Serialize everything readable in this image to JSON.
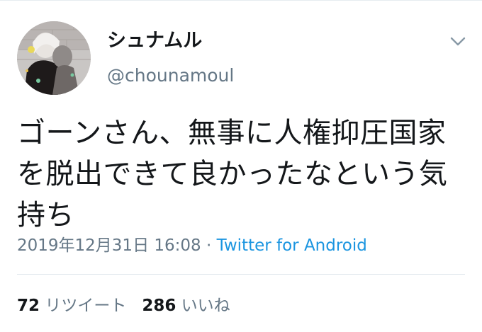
{
  "user": {
    "display_name": "シュナムル",
    "handle": "@chounamoul"
  },
  "tweet": {
    "text": "ゴーンさん、無事に人権抑圧国家を脱出できて良かったなという気持ち",
    "timestamp": "2019年12月31日 16:08",
    "separator": " · ",
    "source": "Twitter for Android"
  },
  "stats": {
    "retweets_count": "72",
    "retweets_label": "リツイート",
    "likes_count": "286",
    "likes_label": "いいね"
  },
  "icons": {
    "menu": "chevron-down-icon",
    "avatar": "avatar"
  },
  "colors": {
    "text": "#14171a",
    "secondary": "#657786",
    "link": "#1b95e0",
    "divider": "#e1e8ed"
  }
}
